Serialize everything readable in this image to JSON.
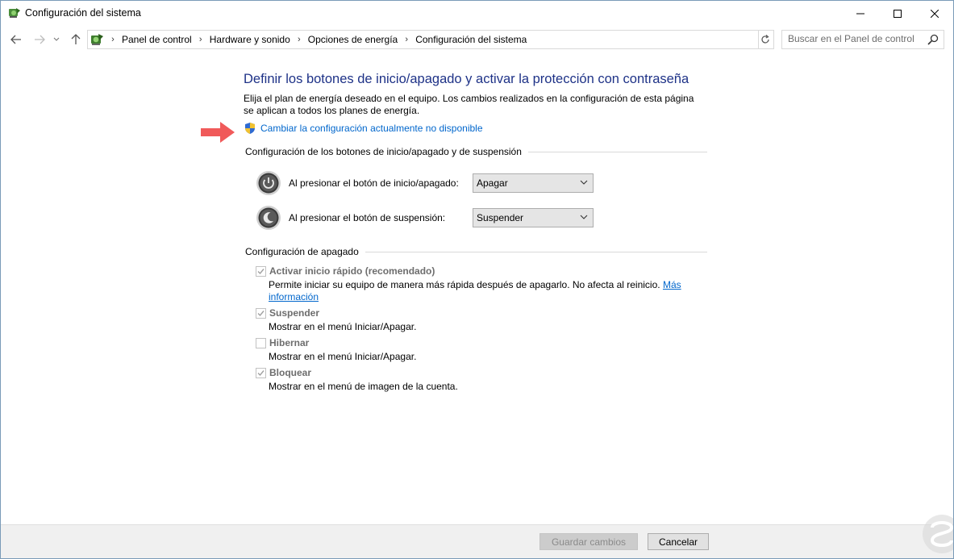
{
  "window": {
    "title": "Configuración del sistema"
  },
  "address_bar": {
    "breadcrumbs": [
      "Panel de control",
      "Hardware y sonido",
      "Opciones de energía",
      "Configuración del sistema"
    ]
  },
  "search": {
    "placeholder": "Buscar en el Panel de control"
  },
  "main": {
    "heading": "Definir los botones de inicio/apagado y activar la protección con contraseña",
    "description": "Elija el plan de energía deseado en el equipo. Los cambios realizados en la configuración de esta página se aplican a todos los planes de energía.",
    "change_link": "Cambiar la configuración actualmente no disponible",
    "buttons_section": {
      "title": "Configuración de los botones de inicio/apagado y de suspensión",
      "power_button_label": "Al presionar el botón de inicio/apagado:",
      "power_button_value": "Apagar",
      "sleep_button_label": "Al presionar el botón de suspensión:",
      "sleep_button_value": "Suspender"
    },
    "shutdown_section": {
      "title": "Configuración de apagado",
      "options": [
        {
          "title": "Activar inicio rápido (recomendado)",
          "description_line1": "Permite iniciar su equipo de manera más rápida después de apagarlo. No afecta al reinicio.",
          "link_part1": "Más",
          "link_part2": "información",
          "checked": true
        },
        {
          "title": "Suspender",
          "description": "Mostrar en el menú Iniciar/Apagar.",
          "checked": true
        },
        {
          "title": "Hibernar",
          "description": "Mostrar en el menú Iniciar/Apagar.",
          "checked": false
        },
        {
          "title": "Bloquear",
          "description": "Mostrar en el menú de imagen de la cuenta.",
          "checked": true
        }
      ]
    }
  },
  "footer": {
    "save_label": "Guardar cambios",
    "cancel_label": "Cancelar"
  },
  "icons": {
    "app": "power-options-icon",
    "back": "back-arrow-icon",
    "forward": "forward-arrow-icon",
    "recent": "chevron-down-icon",
    "up": "up-arrow-icon",
    "refresh": "refresh-icon",
    "search": "search-icon",
    "shield": "uac-shield-icon",
    "power": "power-button-icon",
    "sleep": "sleep-button-icon"
  },
  "colors": {
    "heading": "#1e3287",
    "link": "#0066cc",
    "arrow": "#f05a5a",
    "disabled_text": "#6d6d6d"
  }
}
